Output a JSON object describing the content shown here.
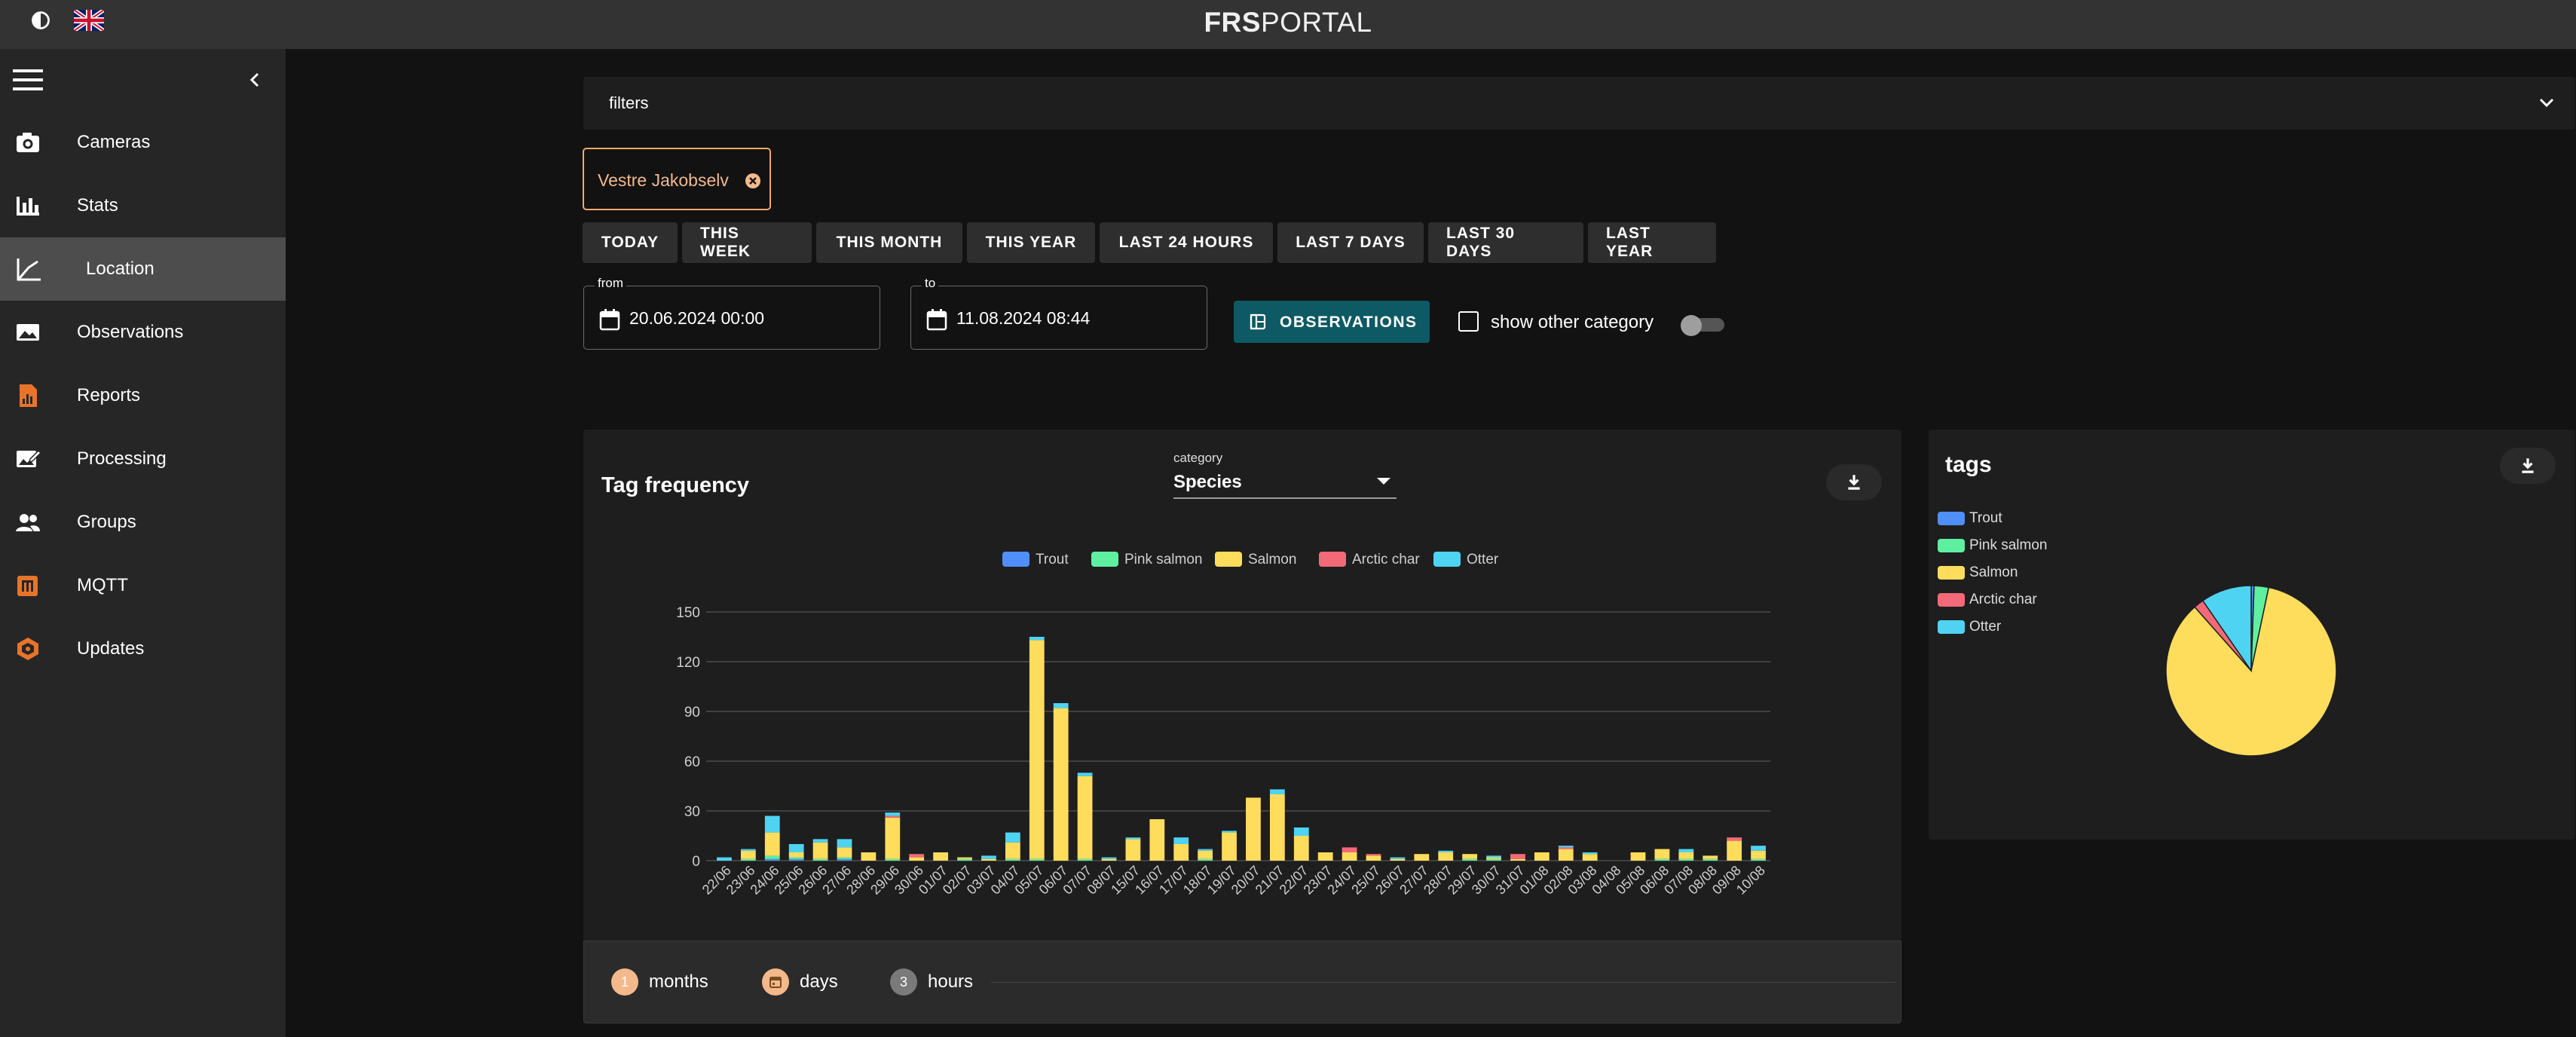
{
  "header": {
    "brand_bold": "FRS",
    "brand_light": "PORTAL",
    "theme_icon": "contrast-icon",
    "language_icon": "uk-flag-icon"
  },
  "sidebar": {
    "items": [
      {
        "label": "Cameras",
        "icon": "camera-icon"
      },
      {
        "label": "Stats",
        "icon": "bar-chart-icon"
      },
      {
        "label": "Location",
        "icon": "line-chart-icon",
        "active": true
      },
      {
        "label": "Observations",
        "icon": "image-icon"
      },
      {
        "label": "Reports",
        "icon": "report-icon"
      },
      {
        "label": "Processing",
        "icon": "edit-image-icon"
      },
      {
        "label": "Groups",
        "icon": "groups-icon"
      },
      {
        "label": "MQTT",
        "icon": "mqtt-icon"
      },
      {
        "label": "Updates",
        "icon": "updates-icon"
      }
    ]
  },
  "filters": {
    "label": "filters"
  },
  "location_chip": {
    "label": "Vestre Jakobselv"
  },
  "ranges": [
    "TODAY",
    "THIS WEEK",
    "THIS MONTH",
    "THIS YEAR",
    "LAST 24 HOURS",
    "LAST 7 DAYS",
    "LAST 30 DAYS",
    "LAST YEAR"
  ],
  "date_from": {
    "label": "from",
    "value": "20.06.2024 00:00"
  },
  "date_to": {
    "label": "to",
    "value": "11.08.2024 08:44"
  },
  "observations_button": "OBSERVATIONS",
  "show_other": {
    "label": "show other category",
    "checked": false,
    "toggle_on": false
  },
  "tag_frequency": {
    "title": "Tag frequency",
    "category_label": "category",
    "category_value": "Species"
  },
  "stepper": [
    {
      "num": "1",
      "label": "months"
    },
    {
      "num": "",
      "label": "days"
    },
    {
      "num": "3",
      "label": "hours"
    }
  ],
  "tags_card": {
    "title": "tags"
  },
  "colors": {
    "Trout": "#4f8ff7",
    "Pink salmon": "#5ef0a0",
    "Salmon": "#fedc5c",
    "Arctic char": "#f26a78",
    "Otter": "#4fd3f2",
    "accent": "#f0a86a",
    "button_primary": "#0e5a64"
  },
  "chart_data": [
    {
      "type": "bar",
      "stacked": true,
      "title": "Tag frequency",
      "legend": [
        "Trout",
        "Pink salmon",
        "Salmon",
        "Arctic char",
        "Otter"
      ],
      "legend_position": "top",
      "ylim": [
        0,
        150
      ],
      "yticks": [
        0,
        30,
        60,
        90,
        120,
        150
      ],
      "grid": true,
      "categories": [
        "22/06",
        "23/06",
        "24/06",
        "25/06",
        "26/06",
        "27/06",
        "28/06",
        "29/06",
        "30/06",
        "01/07",
        "02/07",
        "03/07",
        "04/07",
        "05/07",
        "06/07",
        "07/07",
        "08/07",
        "15/07",
        "16/07",
        "17/07",
        "18/07",
        "19/07",
        "20/07",
        "21/07",
        "22/07",
        "23/07",
        "24/07",
        "25/07",
        "26/07",
        "27/07",
        "28/07",
        "29/07",
        "30/07",
        "31/07",
        "01/08",
        "02/08",
        "03/08",
        "04/08",
        "05/08",
        "06/08",
        "07/08",
        "08/08",
        "09/08",
        "10/08"
      ],
      "series": [
        {
          "name": "Trout",
          "values": [
            0,
            0,
            1,
            1,
            0,
            1,
            0,
            0,
            0,
            0,
            0,
            0,
            0,
            0,
            0,
            0,
            0,
            0,
            0,
            0,
            0,
            0,
            0,
            0,
            0,
            0,
            0,
            0,
            0,
            0,
            0,
            0,
            0,
            0,
            0,
            0,
            0,
            0,
            0,
            0,
            0,
            0,
            0,
            0
          ]
        },
        {
          "name": "Pink salmon",
          "values": [
            0,
            1,
            2,
            1,
            1,
            1,
            0,
            1,
            0,
            0,
            1,
            0,
            1,
            1,
            0,
            1,
            0,
            0,
            0,
            0,
            1,
            0,
            0,
            0,
            0,
            0,
            0,
            0,
            0,
            0,
            0,
            1,
            1,
            0,
            0,
            0,
            0,
            0,
            0,
            1,
            1,
            1,
            0,
            1
          ]
        },
        {
          "name": "Salmon",
          "values": [
            0,
            5,
            14,
            3,
            10,
            6,
            5,
            25,
            2,
            5,
            1,
            1,
            10,
            132,
            92,
            50,
            1,
            13,
            25,
            10,
            5,
            17,
            38,
            40,
            15,
            5,
            5,
            3,
            1,
            4,
            5,
            3,
            1,
            1,
            5,
            7,
            4,
            0,
            5,
            6,
            4,
            2,
            12,
            5
          ]
        },
        {
          "name": "Arctic char",
          "values": [
            0,
            0,
            0,
            0,
            0,
            0,
            0,
            1,
            2,
            0,
            0,
            0,
            0,
            0,
            0,
            0,
            0,
            0,
            0,
            0,
            0,
            0,
            0,
            0,
            0,
            0,
            3,
            1,
            0,
            0,
            0,
            0,
            0,
            3,
            0,
            1,
            0,
            0,
            0,
            0,
            0,
            0,
            2,
            0
          ]
        },
        {
          "name": "Otter",
          "values": [
            2,
            1,
            10,
            5,
            2,
            5,
            0,
            2,
            0,
            0,
            0,
            2,
            6,
            2,
            3,
            2,
            1,
            1,
            0,
            4,
            1,
            1,
            0,
            3,
            5,
            0,
            0,
            0,
            1,
            0,
            1,
            0,
            1,
            0,
            0,
            1,
            1,
            0,
            0,
            0,
            2,
            0,
            0,
            3
          ]
        }
      ]
    },
    {
      "type": "pie",
      "title": "tags",
      "legend_position": "left",
      "slices": [
        {
          "name": "Trout",
          "value": 4
        },
        {
          "name": "Pink salmon",
          "value": 20
        },
        {
          "name": "Salmon",
          "value": 620
        },
        {
          "name": "Arctic char",
          "value": 14
        },
        {
          "name": "Otter",
          "value": 70
        }
      ]
    }
  ]
}
